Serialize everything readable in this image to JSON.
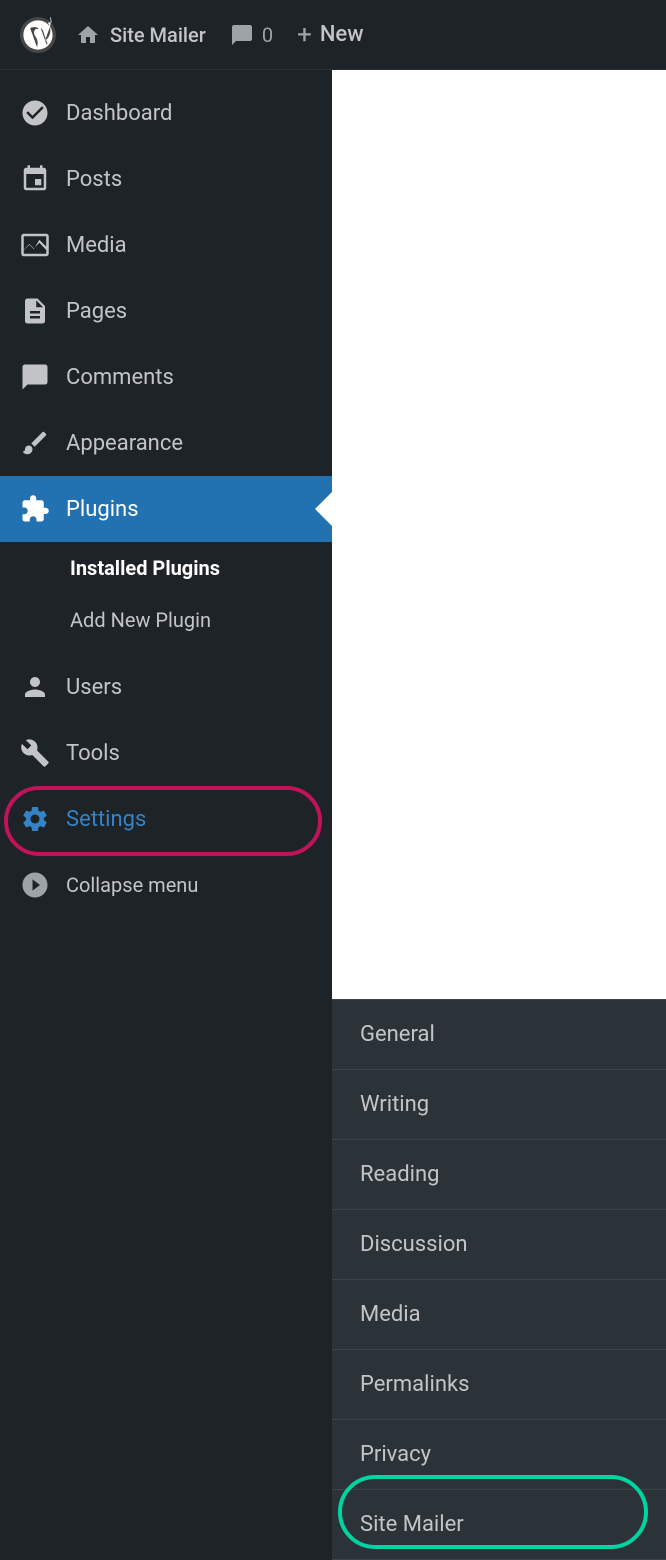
{
  "adminBar": {
    "siteName": "Site Mailer",
    "commentsCount": "0",
    "newLabel": "New"
  },
  "sidebar": {
    "items": [
      {
        "id": "dashboard",
        "label": "Dashboard",
        "icon": "dashboard"
      },
      {
        "id": "posts",
        "label": "Posts",
        "icon": "posts"
      },
      {
        "id": "media",
        "label": "Media",
        "icon": "media"
      },
      {
        "id": "pages",
        "label": "Pages",
        "icon": "pages"
      },
      {
        "id": "comments",
        "label": "Comments",
        "icon": "comments"
      },
      {
        "id": "appearance",
        "label": "Appearance",
        "icon": "appearance"
      },
      {
        "id": "plugins",
        "label": "Plugins",
        "icon": "plugins",
        "active": true
      },
      {
        "id": "users",
        "label": "Users",
        "icon": "users"
      },
      {
        "id": "tools",
        "label": "Tools",
        "icon": "tools"
      },
      {
        "id": "settings",
        "label": "Settings",
        "icon": "settings"
      }
    ],
    "pluginsSubmenu": [
      {
        "id": "installed-plugins",
        "label": "Installed Plugins",
        "active": true
      },
      {
        "id": "add-new-plugin",
        "label": "Add New Plugin",
        "active": false
      }
    ],
    "collapseMenu": "Collapse menu"
  },
  "settingsSubmenu": {
    "items": [
      {
        "id": "general",
        "label": "General"
      },
      {
        "id": "writing",
        "label": "Writing"
      },
      {
        "id": "reading",
        "label": "Reading"
      },
      {
        "id": "discussion",
        "label": "Discussion"
      },
      {
        "id": "media",
        "label": "Media"
      },
      {
        "id": "permalinks",
        "label": "Permalinks"
      },
      {
        "id": "privacy",
        "label": "Privacy"
      },
      {
        "id": "site-mailer",
        "label": "Site Mailer",
        "highlighted": true
      }
    ]
  }
}
